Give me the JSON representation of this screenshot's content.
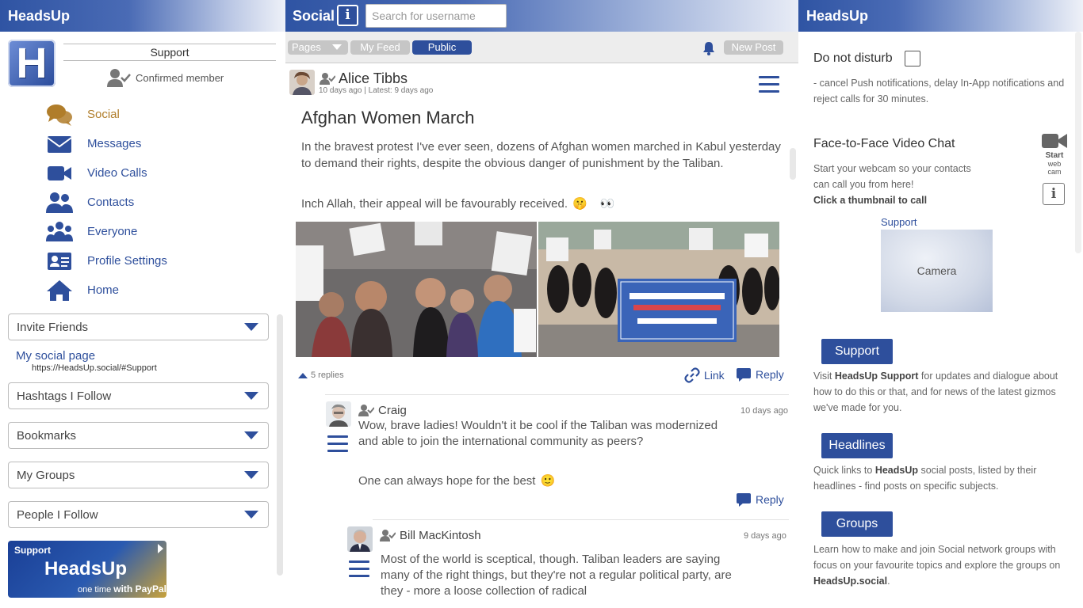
{
  "left": {
    "header": "HeadsUp",
    "logo_letter": "H",
    "support_name": "Support",
    "member_status": "Confirmed member",
    "nav": [
      {
        "label": "Social",
        "icon": "chat-bubbles-icon"
      },
      {
        "label": "Messages",
        "icon": "envelope-icon"
      },
      {
        "label": "Video Calls",
        "icon": "video-camera-icon"
      },
      {
        "label": "Contacts",
        "icon": "contacts-icon"
      },
      {
        "label": "Everyone",
        "icon": "group-icon"
      },
      {
        "label": "Profile Settings",
        "icon": "id-card-icon"
      },
      {
        "label": "Home",
        "icon": "home-icon"
      }
    ],
    "dropdowns": {
      "invite": "Invite Friends",
      "hashtags": "Hashtags I Follow",
      "bookmarks": "Bookmarks",
      "groups": "My Groups",
      "people": "People I Follow"
    },
    "my_social_label": "My social page",
    "my_social_url": "https://HeadsUp.social/#Support",
    "paypal": {
      "line1": "Support",
      "line2": "HeadsUp",
      "line3_prefix": "one time",
      "line3_brand": "with PayPal"
    }
  },
  "mid": {
    "title": "Social",
    "info": "i",
    "search_placeholder": "Search for username",
    "toolbar": {
      "pages": "Pages",
      "feed": "My Feed",
      "public": "Public",
      "new_post": "New Post"
    },
    "post": {
      "author": "Alice Tibbs",
      "time": "10 days ago | Latest: 9 days ago",
      "title": "Afghan Women March",
      "body": "In the bravest protest I've ever seen, dozens of Afghan women marched in Kabul yesterday to demand their rights, despite the obvious danger of punishment by the Taliban.",
      "body2": "Inch Allah, their appeal will be favourably received.",
      "emoji1": "🤫",
      "emoji2": "👀",
      "replies": "5 replies",
      "link": "Link",
      "reply": "Reply"
    },
    "comments": [
      {
        "author": "Craig",
        "time": "10 days ago",
        "text": "Wow, brave ladies! Wouldn't it be cool if the Taliban was modernized and able to join the international community as peers?",
        "text2": "One can always hope for the best",
        "emoji": "🙂",
        "reply": "Reply"
      },
      {
        "author": "Bill MacKintosh",
        "time": "9 days ago",
        "text": "Most of the world is sceptical, though. Taliban leaders are saying many of the right things, but they're not a regular political party, are they - more a loose collection of radical"
      }
    ]
  },
  "right": {
    "header": "HeadsUp",
    "dnd_label": "Do not disturb",
    "dnd_desc": "- cancel Push notifications, delay In-App notifications and reject calls for 30 minutes.",
    "video_title": "Face-to-Face Video Chat",
    "video_desc": "Start your webcam so your contacts can call you from here!",
    "video_hint": "Click a thumbnail to call",
    "webcam_start": "Start",
    "webcam_web": "web",
    "webcam_cam": "cam",
    "info": "i",
    "camera_user": "Support",
    "camera_label": "Camera",
    "support_btn": "Support",
    "support_desc_pre": "Visit ",
    "support_desc_bold": "HeadsUp Support",
    "support_desc_post": " for updates and dialogue about how to do this or that, and for news of the latest gizmos we've made for you.",
    "headlines_btn": "Headlines",
    "headlines_desc_pre": "Quick links to ",
    "headlines_desc_bold": "HeadsUp",
    "headlines_desc_post": " social posts, listed by their headlines - find posts on specific subjects.",
    "groups_btn": "Groups",
    "groups_desc_pre": "Learn how to make and join Social network groups with focus on your favourite topics and explore the groups on ",
    "groups_desc_bold": "HeadsUp.social",
    "groups_desc_post": "."
  }
}
